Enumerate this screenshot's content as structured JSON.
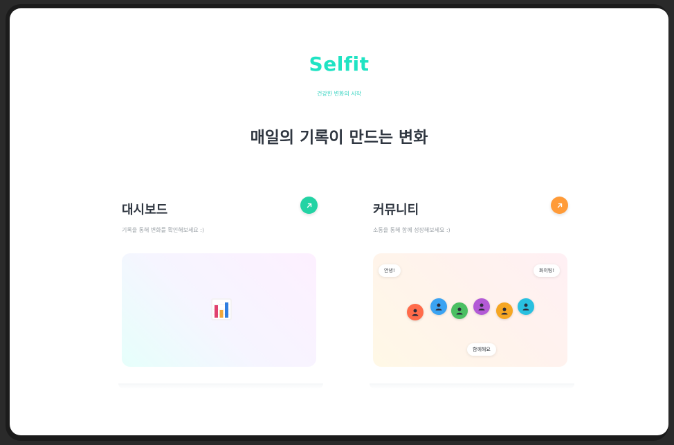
{
  "brand": {
    "name": "Selfit",
    "tagline": "건강한 변화의 시작"
  },
  "headline": "매일의 기록이 만드는 변화",
  "cards": [
    {
      "title": "대시보드",
      "description": "기록을 통해 변화를 확인해보세요 :)",
      "accent": "#23d3a4",
      "icon": "bar-chart-icon"
    },
    {
      "title": "커뮤니티",
      "description": "소통을 통해 함께 성장해보세요 :)",
      "accent": "#ff9b38",
      "bubbles": {
        "left": "안녕!",
        "right": "화이팅!",
        "bottom": "함께해요"
      },
      "avatar_colors": [
        "#ff6b4a",
        "#3ba3f2",
        "#4bbf62",
        "#b35ad6",
        "#f5a623",
        "#29c0e0"
      ]
    }
  ],
  "colors": {
    "brand": "#1fe3c3",
    "heading": "#2f3640",
    "muted": "#9aa0a6"
  }
}
